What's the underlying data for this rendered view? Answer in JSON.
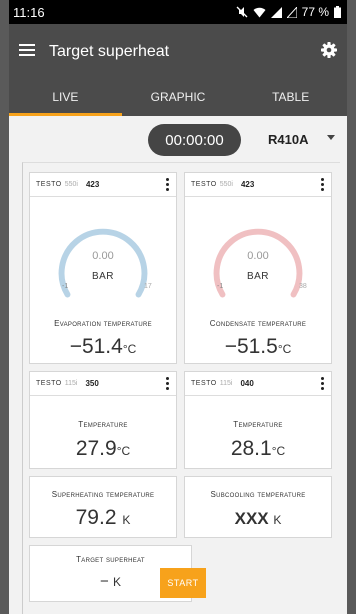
{
  "status": {
    "time": "11:16",
    "battery": "77 %"
  },
  "appbar": {
    "title": "Target superheat"
  },
  "tabs": [
    "LIVE",
    "GRAPHIC",
    "TABLE"
  ],
  "timer": "00:00:00",
  "refrigerant": "R410A",
  "colors": {
    "accent": "#f7a21b",
    "low_arc": "#b7d3e6",
    "high_arc": "#f0c0c2",
    "header": "#4b4b4b"
  },
  "cards": {
    "evap": {
      "brand": "TESTO",
      "model": "550i",
      "serial": "423",
      "value": "0.00",
      "unit": "BAR",
      "min": "-1",
      "max": "17",
      "label": "Evaporation temperature",
      "temp": "−51.4",
      "temp_unit": "°C"
    },
    "cond": {
      "brand": "TESTO",
      "model": "550i",
      "serial": "423",
      "value": "0.00",
      "unit": "BAR",
      "min": "-1",
      "max": "38",
      "label": "Condensate temperature",
      "temp": "−51.5",
      "temp_unit": "°C"
    },
    "t1": {
      "brand": "TESTO",
      "model": "115i",
      "serial": "350",
      "label": "Temperature",
      "temp": "27.9",
      "temp_unit": "°C"
    },
    "t2": {
      "brand": "TESTO",
      "model": "115i",
      "serial": "040",
      "label": "Temperature",
      "temp": "28.1",
      "temp_unit": "°C"
    },
    "sh": {
      "label": "Superheating temperature",
      "temp": "79.2",
      "temp_unit": "K"
    },
    "sc": {
      "label": "Subcooling temperature",
      "temp": "XXX",
      "temp_unit": "K"
    },
    "target": {
      "label": "Target superheat",
      "temp": "−",
      "temp_unit": "K"
    }
  },
  "start_label": "START"
}
